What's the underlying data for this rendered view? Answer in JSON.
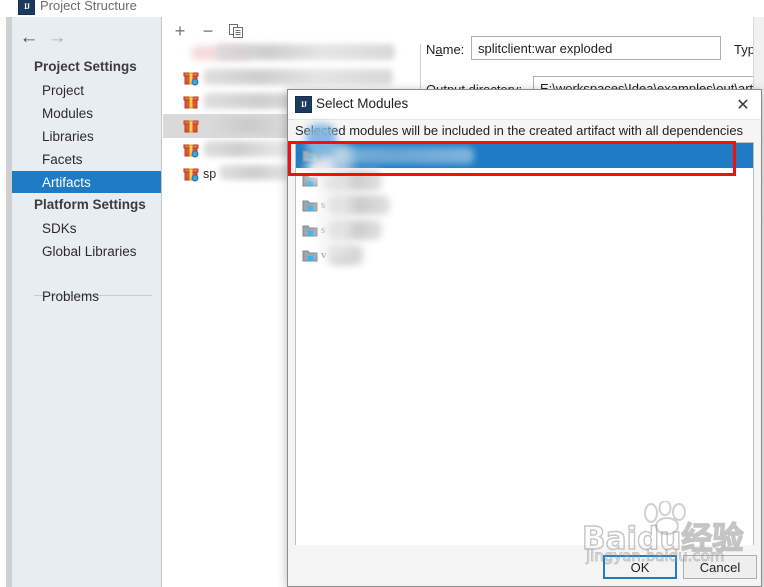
{
  "window": {
    "title": "Project Structure",
    "app_icon": "intellij-idea-icon"
  },
  "navigation": {
    "back_icon": "arrow-left-icon",
    "forward_icon": "arrow-right-icon"
  },
  "sidebar": {
    "groups": [
      {
        "title": "Project Settings",
        "items": [
          {
            "label": "Project",
            "selected": false
          },
          {
            "label": "Modules",
            "selected": false
          },
          {
            "label": "Libraries",
            "selected": false
          },
          {
            "label": "Facets",
            "selected": false
          },
          {
            "label": "Artifacts",
            "selected": true
          }
        ]
      },
      {
        "title": "Platform Settings",
        "items": [
          {
            "label": "SDKs",
            "selected": false
          },
          {
            "label": "Global Libraries",
            "selected": false
          }
        ]
      }
    ],
    "footer_item": {
      "label": "Problems"
    }
  },
  "artifact_toolbar": {
    "add_icon": "plus-icon",
    "remove_icon": "minus-icon",
    "copy_icon": "copy-icon"
  },
  "artifact_tree": {
    "rows": [
      {
        "label": "",
        "icon": "artifact-icon",
        "obscured": true
      },
      {
        "label": "",
        "icon": "artifact-icon",
        "obscured": true
      },
      {
        "label": "",
        "icon": "artifact-icon",
        "obscured": true
      },
      {
        "label": "",
        "icon": "artifact-icon",
        "obscured": true
      },
      {
        "label": "sp",
        "icon": "artifact-icon",
        "obscured": true
      }
    ]
  },
  "form": {
    "name_label": "Name:",
    "name_value": "splitclient:war exploded",
    "type_label": "Typ",
    "output_dir_label": "Output directory:",
    "output_dir_value": "E:\\workspaces\\Idea\\examples\\out\\art"
  },
  "dialog": {
    "icon": "intellij-idea-icon",
    "title": "Select Modules",
    "close_icon": "close-icon",
    "description": "Selected modules will be included in the created artifact with all dependencies",
    "modules": [
      {
        "label": "",
        "icon": "module-icon",
        "selected": true,
        "obscured": true
      },
      {
        "label": "",
        "icon": "module-icon",
        "selected": false,
        "obscured": true
      },
      {
        "label": "",
        "icon": "module-icon",
        "selected": false,
        "obscured": true
      },
      {
        "label": "",
        "icon": "module-icon",
        "selected": false,
        "obscured": true
      },
      {
        "label": "",
        "icon": "module-icon",
        "selected": false,
        "obscured": true
      }
    ],
    "ok_label": "OK",
    "cancel_label": "Cancel"
  },
  "annotation": {
    "shape": "rectangle",
    "color": "#ee1111",
    "target": "first-module-row"
  },
  "watermark": {
    "main": "Baidu经验",
    "sub": "jingyan.baidu.com",
    "logo_icon": "paw-print-icon"
  },
  "colors": {
    "selection_blue": "#1f7cc4",
    "sidebar_bg": "#e8edf1",
    "annotation_red": "#ee1111",
    "dialog_bg": "#f5f5f5"
  }
}
